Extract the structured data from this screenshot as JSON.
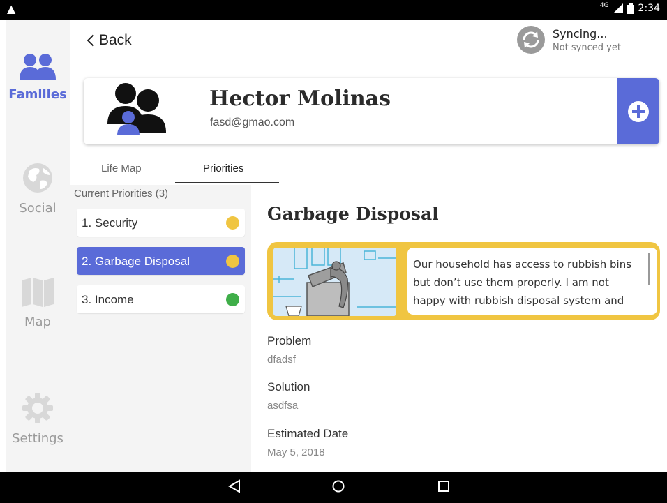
{
  "status_bar": {
    "network": "4G",
    "time": "2:34"
  },
  "sidebar": {
    "items": [
      {
        "label": "Families",
        "icon": "families-icon",
        "active": true
      },
      {
        "label": "Social",
        "icon": "globe-icon",
        "active": false
      },
      {
        "label": "Map",
        "icon": "map-icon",
        "active": false
      },
      {
        "label": "Settings",
        "icon": "gear-icon",
        "active": false
      }
    ]
  },
  "header": {
    "back_label": "Back",
    "sync_title": "Syncing...",
    "sync_subtitle": "Not synced yet"
  },
  "family": {
    "name": "Hector Molinas",
    "email": "fasd@gmao.com"
  },
  "tabs": [
    {
      "label": "Life Map",
      "active": false
    },
    {
      "label": "Priorities",
      "active": true
    }
  ],
  "priorities": {
    "header": "Current Priorities (3)",
    "items": [
      {
        "label": "1. Security",
        "color": "#f0c541",
        "selected": false
      },
      {
        "label": "2. Garbage Disposal",
        "color": "#f0c541",
        "selected": true
      },
      {
        "label": "3. Income",
        "color": "#3fae49",
        "selected": false
      }
    ]
  },
  "detail": {
    "title": "Garbage Disposal",
    "description": "Our household has access to rubbish bins but don’t use them properly. I am not happy with rubbish disposal system and",
    "problem_label": "Problem",
    "problem_value": "dfadsf",
    "solution_label": "Solution",
    "solution_value": "asdfsa",
    "date_label": "Estimated Date",
    "date_value": "May 5, 2018"
  },
  "colors": {
    "accent": "#5a6bd8",
    "yellow": "#f0c541",
    "green": "#3fae49"
  }
}
